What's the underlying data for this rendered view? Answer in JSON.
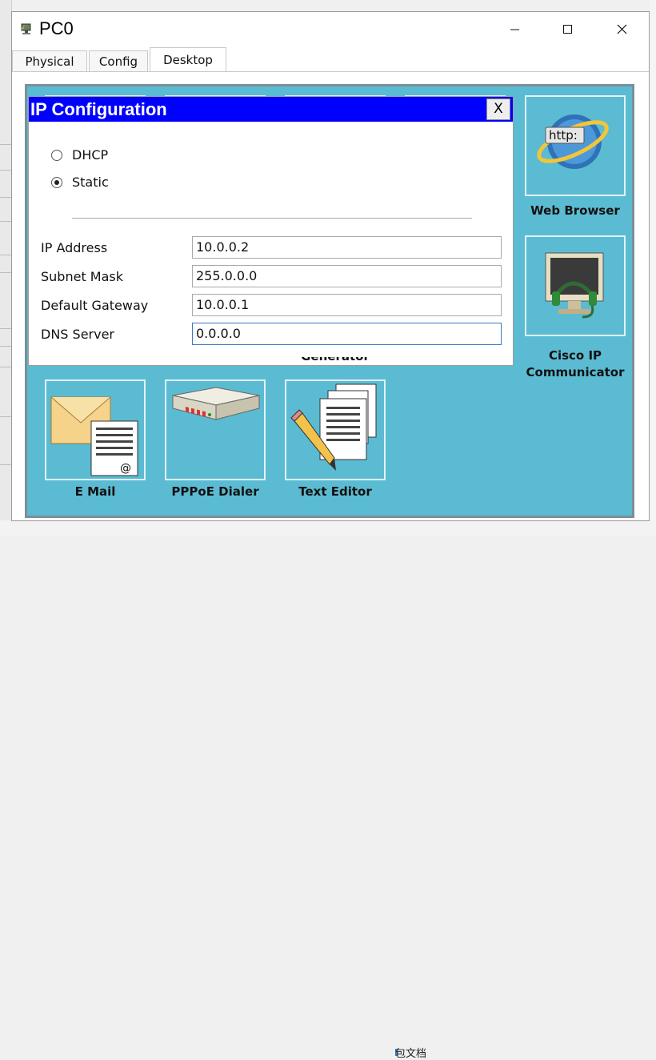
{
  "window": {
    "title": "PC0",
    "minimize_icon": "minimize-icon",
    "maximize_icon": "maximize-icon",
    "close_icon": "close-icon"
  },
  "tabs": [
    {
      "label": "Physical",
      "active": false
    },
    {
      "label": "Config",
      "active": false
    },
    {
      "label": "Desktop",
      "active": true
    }
  ],
  "desktop": {
    "apps": [
      {
        "label": "Web Browser",
        "icon": "web-browser-icon"
      },
      {
        "label": "Cisco IP Communicator",
        "icon": "ip-phone-icon"
      },
      {
        "label": "E Mail",
        "icon": "email-icon"
      },
      {
        "label": "PPPoE Dialer",
        "icon": "dialer-icon"
      },
      {
        "label": "Text Editor",
        "icon": "text-editor-icon"
      }
    ],
    "partial_label": "Generator"
  },
  "ip_config": {
    "title": "IP Configuration",
    "close_label": "X",
    "modes": [
      {
        "label": "DHCP",
        "selected": false
      },
      {
        "label": "Static",
        "selected": true
      }
    ],
    "fields": [
      {
        "label": "IP Address",
        "value": "10.0.0.2"
      },
      {
        "label": "Subnet Mask",
        "value": "255.0.0.0"
      },
      {
        "label": "Default Gateway",
        "value": "10.0.0.1"
      },
      {
        "label": "DNS Server",
        "value": "0.0.0.0"
      }
    ]
  },
  "background": {
    "bottom_text": "包文档"
  }
}
